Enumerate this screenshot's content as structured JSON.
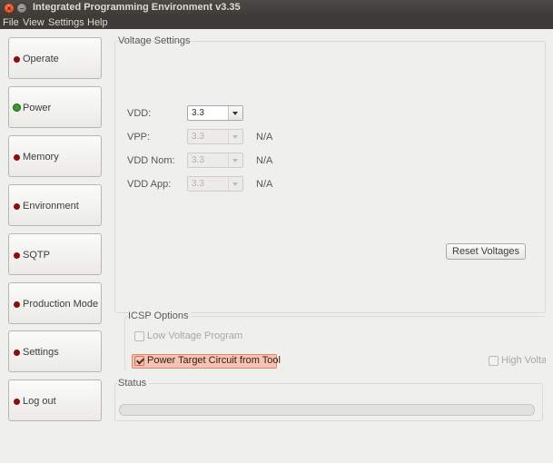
{
  "window": {
    "title": "Integrated Programming Environment v3.35",
    "close_glyph": "×",
    "min_glyph": "–"
  },
  "menu": [
    "File",
    "View",
    "Settings",
    "Help"
  ],
  "sidebar": {
    "items": [
      {
        "label": "Operate",
        "led": "red"
      },
      {
        "label": "Power",
        "led": "green"
      },
      {
        "label": "Memory",
        "led": "red"
      },
      {
        "label": "Environment",
        "led": "red"
      },
      {
        "label": "SQTP",
        "led": "red"
      },
      {
        "label": "Production Mode",
        "led": "red"
      },
      {
        "label": "Settings",
        "led": "red"
      },
      {
        "label": "Log out",
        "led": "red"
      }
    ]
  },
  "voltage": {
    "title": "Voltage Settings",
    "rows": [
      {
        "label": "VDD:",
        "value": "3.3",
        "enabled": true,
        "note": ""
      },
      {
        "label": "VPP:",
        "value": "3.3",
        "enabled": false,
        "note": "N/A"
      },
      {
        "label": "VDD Nom:",
        "value": "3.3",
        "enabled": false,
        "note": "N/A"
      },
      {
        "label": "VDD App:",
        "value": "3.3",
        "enabled": false,
        "note": "N/A"
      }
    ],
    "reset_label": "Reset Voltages"
  },
  "icsp": {
    "title": "ICSP Options",
    "low_voltage_label": "Low Voltage Program",
    "low_voltage_checked": false,
    "power_target_label": "Power Target Circuit from Tool",
    "power_target_checked": true,
    "high_voltage_label": "High Voltag",
    "high_voltage_checked": false
  },
  "status": {
    "title": "Status",
    "progress": 0
  },
  "colors": {
    "led_red": "#8b0d0d",
    "led_green": "#3a9a2a",
    "accent": "#e1866a"
  }
}
